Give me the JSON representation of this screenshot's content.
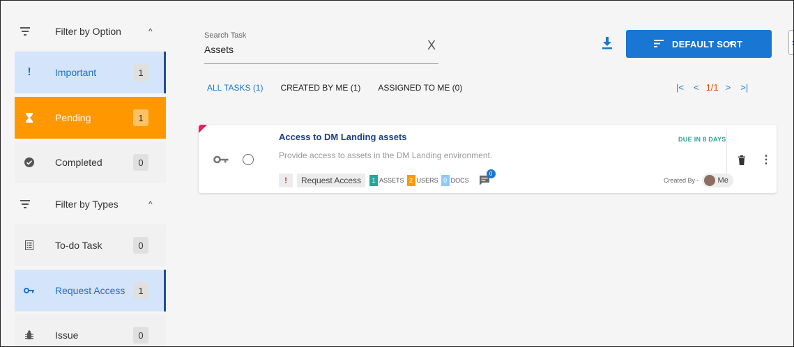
{
  "sidebar": {
    "option_section": {
      "title": "Filter by Option",
      "chevron": "^"
    },
    "option_items": [
      {
        "label": "Important",
        "count": "1",
        "icon": "exclamation-icon"
      },
      {
        "label": "Pending",
        "count": "1",
        "icon": "hourglass-icon"
      },
      {
        "label": "Completed",
        "count": "0",
        "icon": "check-circle-icon"
      }
    ],
    "type_section": {
      "title": "Filter by Types",
      "chevron": "^"
    },
    "type_items": [
      {
        "label": "To-do Task",
        "count": "0",
        "icon": "list-icon"
      },
      {
        "label": "Request Access",
        "count": "1",
        "icon": "key-icon"
      },
      {
        "label": "Issue",
        "count": "0",
        "icon": "bug-icon"
      }
    ]
  },
  "search": {
    "label": "Search Task",
    "value": "Assets",
    "clear": "X"
  },
  "sort": {
    "label": "DEFAULT SORT",
    "caret": "▼"
  },
  "edge_button": ":",
  "tabs": [
    {
      "label": "ALL TASKS (1)",
      "active": true
    },
    {
      "label": "CREATED BY ME (1)",
      "active": false
    },
    {
      "label": "ASSIGNED TO ME (0)",
      "active": false
    }
  ],
  "pager": {
    "first": "|<",
    "prev": "<",
    "page": "1/1",
    "next": ">",
    "last": ">|"
  },
  "task": {
    "title": "Access to DM Landing assets",
    "description": "Provide access to assets in the DM Landing environment.",
    "priority": "!",
    "type": "Request Access",
    "chips": [
      {
        "count": "1",
        "label": "ASSETS",
        "color": "#26a69a"
      },
      {
        "count": "2",
        "label": "USERS",
        "color": "#ff9800"
      },
      {
        "count": "0",
        "label": "DOCS",
        "color": "#90caf9"
      }
    ],
    "comments": "0",
    "due": "DUE IN 8 DAYS",
    "created_by_label": "Created By -",
    "creator": "Me"
  },
  "colors": {
    "accent": "#1976d2",
    "pending": "#ff9800",
    "selected_bg": "#d4e5fb",
    "corner": "#e91e63"
  }
}
